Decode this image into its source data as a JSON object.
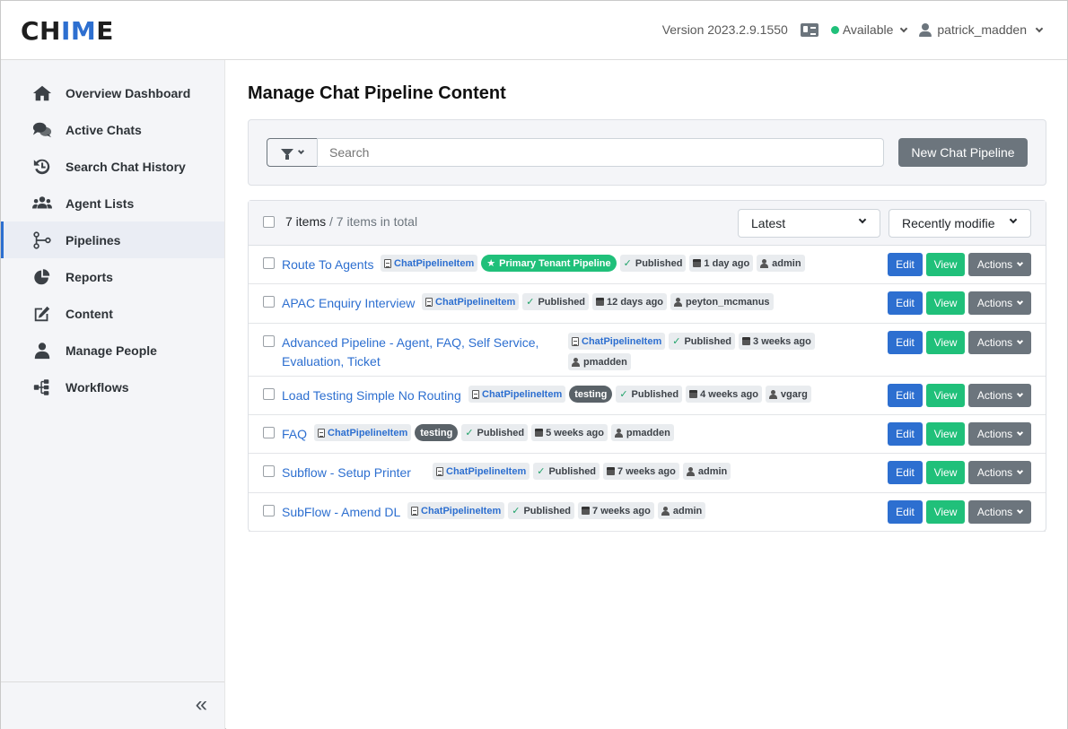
{
  "header": {
    "logo_pre": "CH",
    "logo_accent": "IM",
    "logo_post": "E",
    "version": "Version 2023.2.9.1550",
    "status": "Available",
    "user": "patrick_madden",
    "status_color": "#20c07a"
  },
  "sidebar": {
    "items": [
      {
        "label": "Overview Dashboard",
        "icon": "home-icon"
      },
      {
        "label": "Active Chats",
        "icon": "chat-bubbles-icon"
      },
      {
        "label": "Search Chat History",
        "icon": "history-icon"
      },
      {
        "label": "Agent Lists",
        "icon": "users-icon"
      },
      {
        "label": "Pipelines",
        "icon": "pipeline-icon"
      },
      {
        "label": "Reports",
        "icon": "pie-chart-icon"
      },
      {
        "label": "Content",
        "icon": "edit-icon"
      },
      {
        "label": "Manage People",
        "icon": "user-icon"
      },
      {
        "label": "Workflows",
        "icon": "sitemap-icon"
      }
    ],
    "active": "Pipelines",
    "collapse": "«"
  },
  "main": {
    "title": "Manage Chat Pipeline Content",
    "search_placeholder": "Search",
    "new_button": "New Chat Pipeline",
    "count": "7 items",
    "count_total": " / 7 items in total",
    "sort_select": "Latest",
    "order_select": "Recently modifie",
    "edit_label": "Edit",
    "view_label": "View",
    "actions_label": "Actions",
    "rows": [
      {
        "title": "Route To Agents",
        "type": "ChatPipelineItem",
        "primary": "Primary Tenant Pipeline",
        "testing": "",
        "status": "Published",
        "age": "1 day ago",
        "author": "admin"
      },
      {
        "title": "APAC Enquiry Interview",
        "type": "ChatPipelineItem",
        "primary": "",
        "testing": "",
        "status": "Published",
        "age": "12 days ago",
        "author": "peyton_mcmanus"
      },
      {
        "title": "Advanced Pipeline - Agent, FAQ, Self Service, Evaluation, Ticket",
        "type": "ChatPipelineItem",
        "primary": "",
        "testing": "",
        "status": "Published",
        "age": "3 weeks ago",
        "author": "pmadden"
      },
      {
        "title": "Load Testing Simple No Routing",
        "type": "ChatPipelineItem",
        "primary": "",
        "testing": "testing",
        "status": "Published",
        "age": "4 weeks ago",
        "author": "vgarg"
      },
      {
        "title": "FAQ",
        "type": "ChatPipelineItem",
        "primary": "",
        "testing": "testing",
        "status": "Published",
        "age": "5 weeks ago",
        "author": "pmadden"
      },
      {
        "title": "Subflow - Setup Printer",
        "type": "ChatPipelineItem",
        "primary": "",
        "testing": "",
        "status": "Published",
        "age": "7 weeks ago",
        "author": "admin"
      },
      {
        "title": "SubFlow - Amend DL",
        "type": "ChatPipelineItem",
        "primary": "",
        "testing": "",
        "status": "Published",
        "age": "7 weeks ago",
        "author": "admin"
      }
    ]
  }
}
